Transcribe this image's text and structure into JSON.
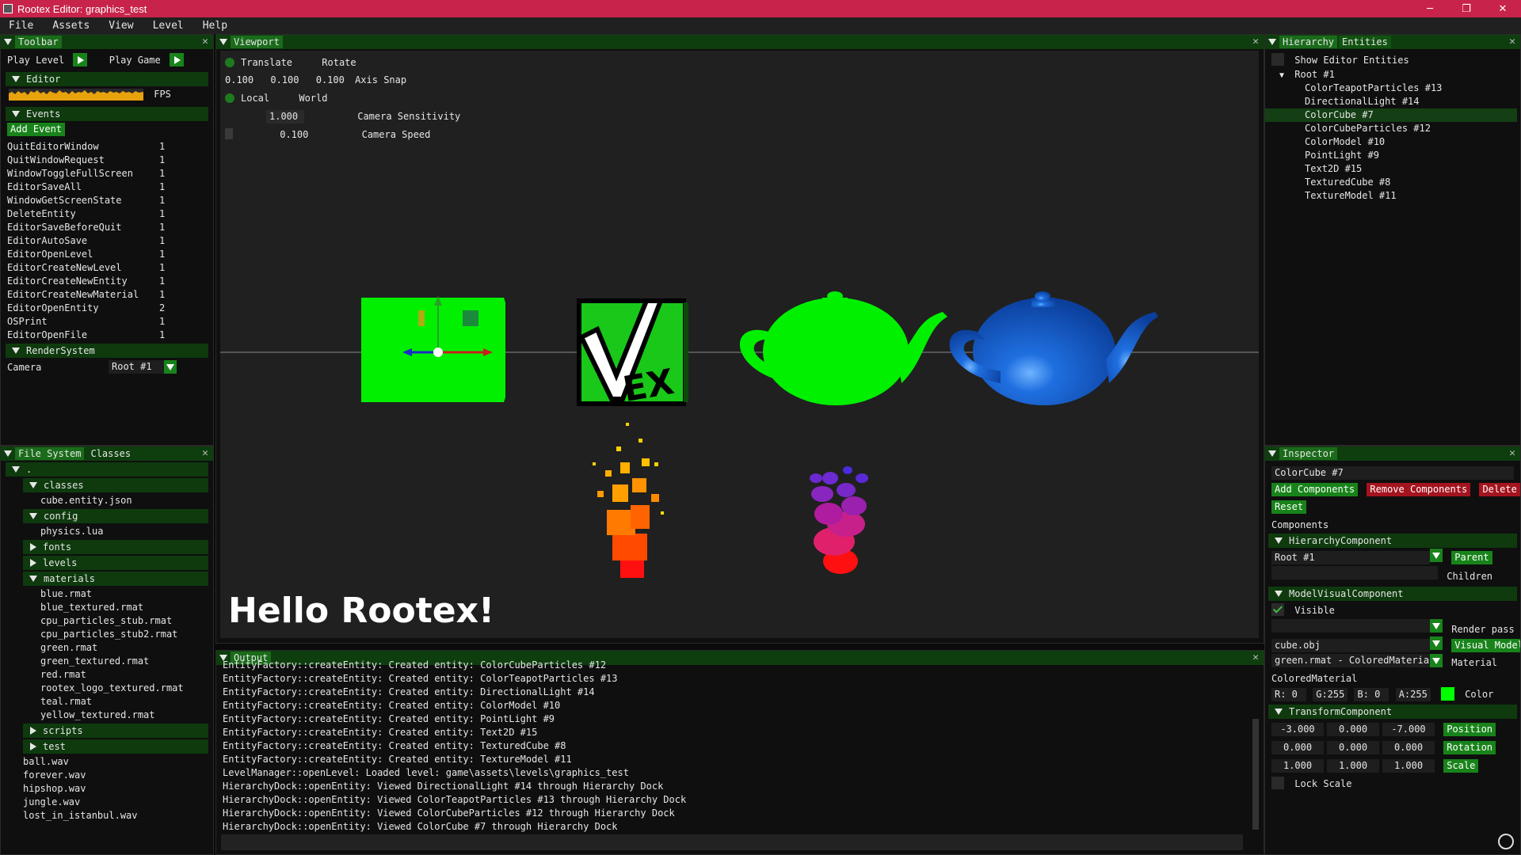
{
  "window": {
    "title": "Rootex Editor: graphics_test",
    "controls": [
      "─",
      "❐",
      "✕"
    ]
  },
  "menu": [
    "File",
    "Assets",
    "View",
    "Level",
    "Help"
  ],
  "toolbar": {
    "tab": "Toolbar",
    "play_level": "Play Level",
    "play_game": "Play Game",
    "editor_section": "Editor",
    "fps_label": "FPS",
    "events_section": "Events",
    "add_event": "Add Event",
    "events": [
      {
        "name": "QuitEditorWindow",
        "count": "1"
      },
      {
        "name": "QuitWindowRequest",
        "count": "1"
      },
      {
        "name": "WindowToggleFullScreen",
        "count": "1"
      },
      {
        "name": "EditorSaveAll",
        "count": "1"
      },
      {
        "name": "WindowGetScreenState",
        "count": "1"
      },
      {
        "name": "DeleteEntity",
        "count": "1"
      },
      {
        "name": "EditorSaveBeforeQuit",
        "count": "1"
      },
      {
        "name": "EditorAutoSave",
        "count": "1"
      },
      {
        "name": "EditorOpenLevel",
        "count": "1"
      },
      {
        "name": "EditorCreateNewLevel",
        "count": "1"
      },
      {
        "name": "EditorCreateNewEntity",
        "count": "1"
      },
      {
        "name": "EditorCreateNewMaterial",
        "count": "1"
      },
      {
        "name": "EditorOpenEntity",
        "count": "2"
      },
      {
        "name": "OSPrint",
        "count": "1"
      },
      {
        "name": "EditorOpenFile",
        "count": "1"
      }
    ],
    "render_section": "RenderSystem",
    "camera_label": "Camera",
    "camera_value": "Root #1"
  },
  "filesystem": {
    "tabs": [
      "File System",
      "Classes"
    ],
    "root": ".",
    "classes": "classes",
    "classes_files": [
      "cube.entity.json"
    ],
    "config": "config",
    "config_files": [
      "physics.lua"
    ],
    "fonts": "fonts",
    "levels": "levels",
    "materials": "materials",
    "material_files": [
      "blue.rmat",
      "blue_textured.rmat",
      "cpu_particles_stub.rmat",
      "cpu_particles_stub2.rmat",
      "green.rmat",
      "green_textured.rmat",
      "red.rmat",
      "rootex_logo_textured.rmat",
      "teal.rmat",
      "yellow_textured.rmat"
    ],
    "scripts": "scripts",
    "test": "test",
    "root_files": [
      "ball.wav",
      "forever.wav",
      "hipshop.wav",
      "jungle.wav",
      "lost_in_istanbul.wav"
    ]
  },
  "viewport": {
    "tab": "Viewport",
    "translate": "Translate",
    "rotate": "Rotate",
    "snap_values": [
      "0.100",
      "0.100",
      "0.100"
    ],
    "axis_snap": "Axis Snap",
    "local": "Local",
    "world": "World",
    "cam_sens_value": "1.000",
    "cam_sens_label": "Camera Sensitivity",
    "cam_speed_value": "0.100",
    "cam_speed_label": "Camera Speed",
    "hello_text": "Hello Rootex!",
    "logo_text": "EX"
  },
  "output": {
    "tab": "Output",
    "lines": [
      "EntityFactory::createEntity: Created entity: ColorCubeParticles #12",
      "EntityFactory::createEntity: Created entity: ColorTeapotParticles #13",
      "EntityFactory::createEntity: Created entity: DirectionalLight #14",
      "EntityFactory::createEntity: Created entity: ColorModel #10",
      "EntityFactory::createEntity: Created entity: PointLight #9",
      "EntityFactory::createEntity: Created entity: Text2D #15",
      "EntityFactory::createEntity: Created entity: TexturedCube #8",
      "EntityFactory::createEntity: Created entity: TextureModel #11",
      "LevelManager::openLevel: Loaded level: game\\assets\\levels\\graphics_test",
      "HierarchyDock::openEntity: Viewed DirectionalLight #14 through Hierarchy Dock",
      "HierarchyDock::openEntity: Viewed ColorTeapotParticles #13 through Hierarchy Dock",
      "HierarchyDock::openEntity: Viewed ColorCubeParticles #12 through Hierarchy Dock",
      "HierarchyDock::openEntity: Viewed ColorCube #7 through Hierarchy Dock"
    ]
  },
  "hierarchy": {
    "tabs": [
      "Hierarchy",
      "Entities"
    ],
    "show_editor": "Show Editor Entities",
    "root": "Root #1",
    "children": [
      "ColorTeapotParticles #13",
      "DirectionalLight #14",
      "ColorCube #7",
      "ColorCubeParticles #12",
      "ColorModel #10",
      "PointLight #9",
      "Text2D #15",
      "TexturedCube #8",
      "TextureModel #11"
    ],
    "selected_index": 2
  },
  "inspector": {
    "tab": "Inspector",
    "entity_name": "ColorCube #7",
    "add_components": "Add Components",
    "remove_components": "Remove Components",
    "delete_entity": "Delete En",
    "reset": "Reset",
    "components_label": "Components",
    "hierarchy_comp": "HierarchyComponent",
    "parent_value": "Root #1",
    "parent_btn": "Parent",
    "children_label": "Children",
    "model_comp": "ModelVisualComponent",
    "visible_label": "Visible",
    "render_pass_label": "Render pass",
    "model_value": "cube.obj",
    "visual_model_btn": "Visual Model",
    "material_value": "green.rmat - ColoredMateria",
    "material_label": "Material",
    "colored_material": "ColoredMaterial",
    "r": "R:  0",
    "g": "G:255",
    "b": "B:  0",
    "a": "A:255",
    "color_label": "Color",
    "color_swatch": "#00ff00",
    "transform_comp": "TransformComponent",
    "position": [
      "-3.000",
      "0.000",
      "-7.000"
    ],
    "position_btn": "Position",
    "rotation": [
      "0.000",
      "0.000",
      "0.000"
    ],
    "rotation_btn": "Rotation",
    "scale": [
      "1.000",
      "1.000",
      "1.000"
    ],
    "scale_btn": "Scale",
    "lock_scale": "Lock Scale"
  }
}
